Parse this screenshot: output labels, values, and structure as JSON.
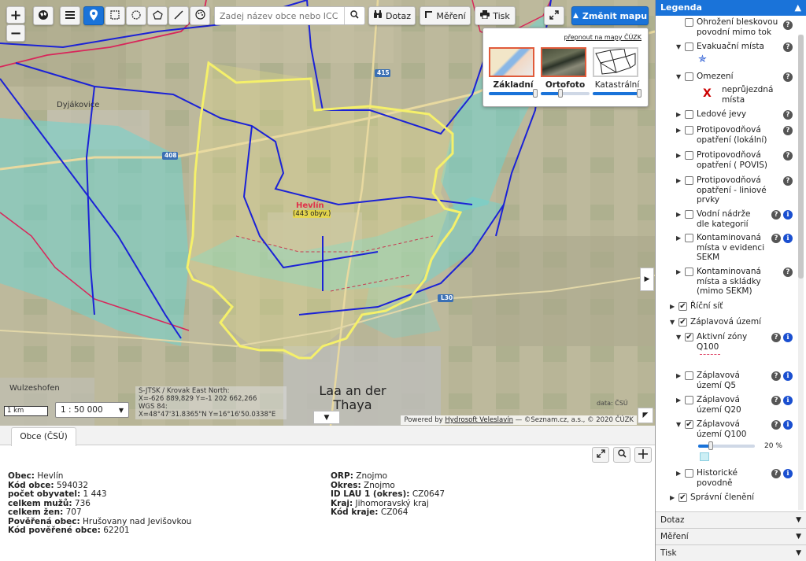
{
  "toolbar": {
    "zoom_in": "+",
    "zoom_out": "−",
    "search_placeholder": "Zadej název obce nebo ICC",
    "query_label": "Dotaz",
    "measure_label": "Měření",
    "print_label": "Tisk",
    "change_map_label": "Změnit mapu"
  },
  "switcher": {
    "link": "přepnout na mapy ČÚZK",
    "types": [
      {
        "label": "Základní",
        "level": 1.0
      },
      {
        "label": "Ortofoto",
        "level": 0.4
      },
      {
        "label": "Katastrální",
        "level": 1.0
      }
    ]
  },
  "map": {
    "place_labels": {
      "hevlin": "Hevlín",
      "hevlin_pop": "(443 obyv.)",
      "dyjakovice": "Dyjákovice",
      "laa": "Laa an der Thaya",
      "wulzeshofen": "Wulzeshofen",
      "road_408": "408",
      "road_415": "415",
      "road_l30": "L30"
    },
    "scale_bar": "1 km",
    "scale_select": "1 : 50 000",
    "coords": {
      "line1": "S-JTSK / Krovak East North:",
      "line2": "X=-626 889,829 Y=-1 202 662,266",
      "line3": "WGS 84:",
      "line4": "X=48°47'31.8365\"N Y=16°16'50.0338\"E"
    },
    "copyright_small": "data: ČSÚ",
    "attribution_prefix": "Powered by ",
    "attribution_link": "Hydrosoft Veleslavín",
    "attribution_suffix": " — ©Seznam.cz, a.s., © 2020 ČÚZK"
  },
  "bottom": {
    "tab": "Obce (ČSÚ)",
    "left_rows": [
      {
        "label": "Obec:",
        "value": "Hevlín"
      },
      {
        "label": "Kód obce:",
        "value": "594032"
      },
      {
        "label": "počet obyvatel:",
        "value": "1 443"
      },
      {
        "label": "celkem mužů:",
        "value": "736"
      },
      {
        "label": "celkem žen:",
        "value": "707"
      },
      {
        "label": "Pověřená obec:",
        "value": "Hrušovany nad Jevišovkou"
      },
      {
        "label": "Kód pověřené obce:",
        "value": "62201"
      }
    ],
    "right_rows": [
      {
        "label": "ORP:",
        "value": "Znojmo"
      },
      {
        "label": "Okres:",
        "value": "Znojmo"
      },
      {
        "label": "ID LAU 1 (okres):",
        "value": "CZ0647"
      },
      {
        "label": "Kraj:",
        "value": "Jihomoravský kraj"
      },
      {
        "label": "Kód kraje:",
        "value": "CZ064"
      }
    ]
  },
  "legend": {
    "title": "Legenda",
    "items": {
      "ohrozeni_1": "Ohrožení bleskovou",
      "ohrozeni_2": "povodní mimo tok",
      "evakuacni": "Evakuační místa",
      "omezeni": "Omezení",
      "nepruj_1": "neprůjezdná",
      "nepruj_2": "místa",
      "ledove": "Ledové jevy",
      "protip_lok_1": "Protipovodňová",
      "protip_lok_2": "opatření (lokální)",
      "protip_povis_1": "Protipovodňová",
      "protip_povis_2": "opatření ( POVIS)",
      "protip_lin_1": "Protipovodňová",
      "protip_lin_2": "opatření - liniové",
      "protip_lin_3": "prvky",
      "vodni_1": "Vodní nádrže",
      "vodni_2": "dle kategorií",
      "kontam1_1": "Kontaminovaná",
      "kontam1_2": "místa v evidenci",
      "kontam1_3": "SEKM",
      "kontam2_1": "Kontaminovaná",
      "kontam2_2": "místa a skládky",
      "kontam2_3": "(mimo SEKM)",
      "ricni": "Říční síť",
      "zaplavova": "Záplavová území",
      "aktivni_1": "Aktivní zóny",
      "aktivni_2": "Q100",
      "q5_1": "Záplavová",
      "q5_2": "území Q5",
      "q20_1": "Záplavová",
      "q20_2": "území Q20",
      "q100_1": "Záplavová",
      "q100_2": "území Q100",
      "q100_opacity": "20 %",
      "historicke_1": "Historické",
      "historicke_2": "povodně",
      "spravni": "Správní členění"
    },
    "q100_opacity_level": 0.2,
    "accordions": [
      "Dotaz",
      "Měření",
      "Tisk"
    ]
  },
  "colors": {
    "accent": "#1a73d9",
    "flood_zone": "#6fd3d0",
    "boundary_yellow": "#f5f06a",
    "district_blue": "#1b22d6",
    "region_red": "#d8265a"
  }
}
